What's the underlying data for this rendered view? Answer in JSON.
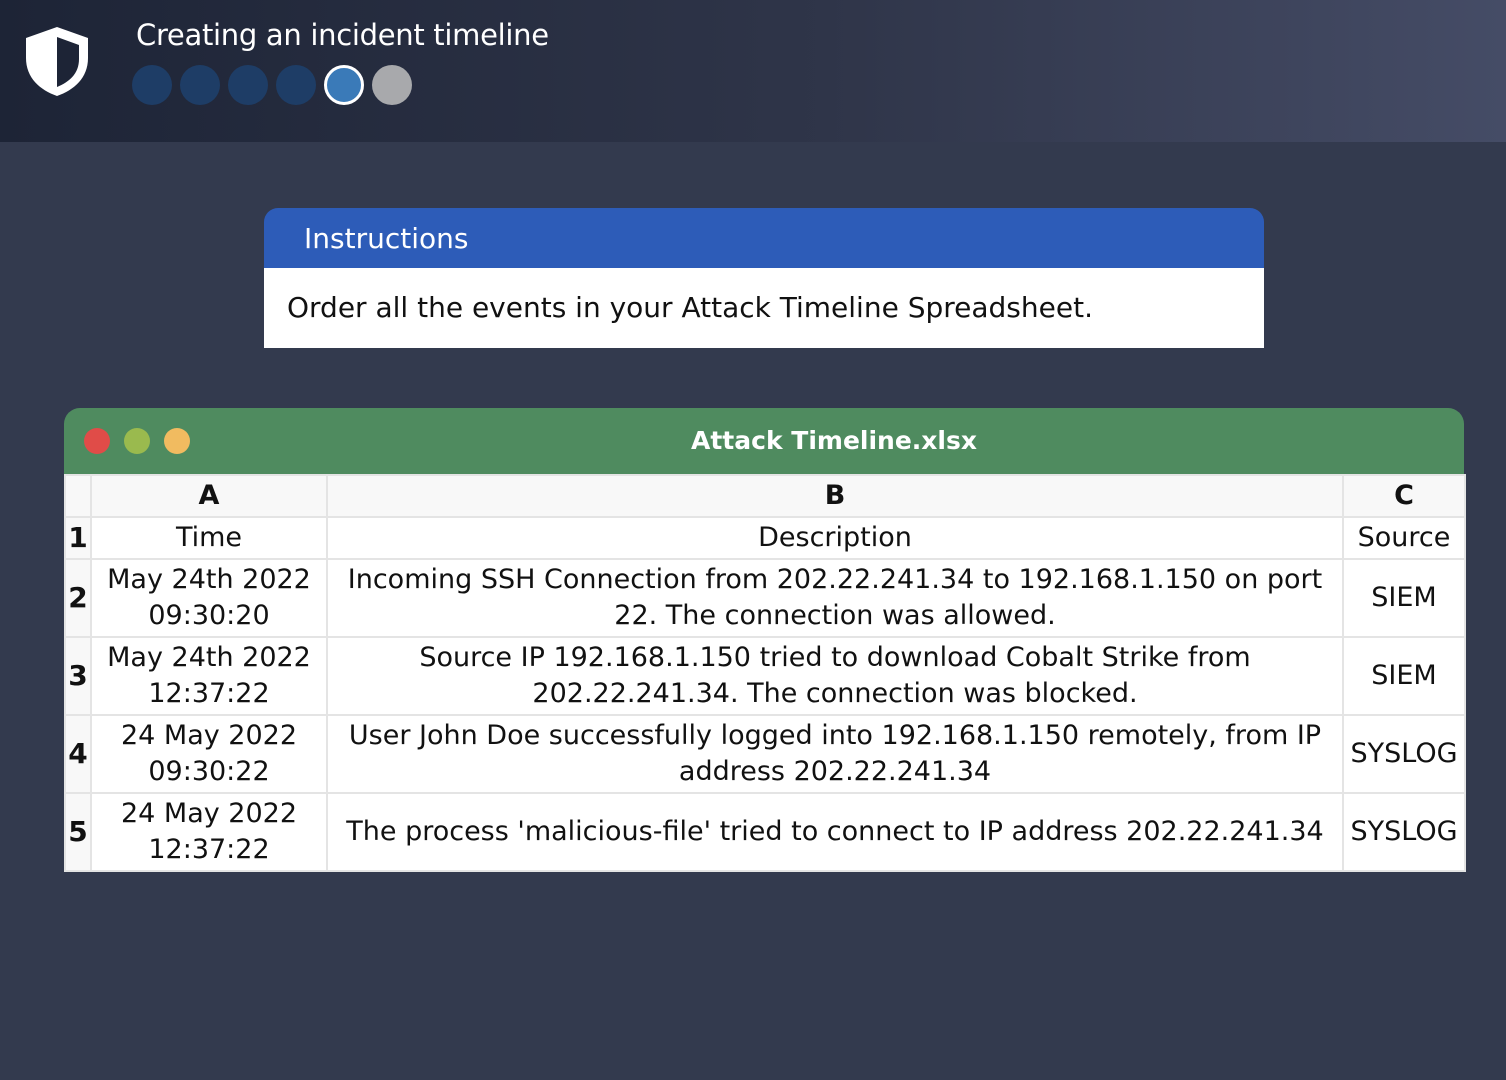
{
  "header": {
    "title": "Creating an incident timeline",
    "progress": {
      "total_steps": 6,
      "completed": 4,
      "current_step": 5
    }
  },
  "instructions": {
    "heading": "Instructions",
    "body": "Order all the events in your Attack Timeline Spreadsheet."
  },
  "spreadsheet": {
    "filename": "Attack Timeline.xlsx",
    "column_letters": [
      "A",
      "B",
      "C"
    ],
    "header_row": {
      "number": "1",
      "time": "Time",
      "description": "Description",
      "source": "Source"
    },
    "rows": [
      {
        "number": "2",
        "time_line1": "May 24th 2022",
        "time_line2": "09:30:20",
        "description": "Incoming SSH Connection from 202.22.241.34 to 192.168.1.150 on port 22. The connection was allowed.",
        "source": "SIEM"
      },
      {
        "number": "3",
        "time_line1": "May 24th 2022",
        "time_line2": "12:37:22",
        "description": "Source IP 192.168.1.150 tried to download Cobalt Strike from 202.22.241.34. The connection was blocked.",
        "source": "SIEM"
      },
      {
        "number": "4",
        "time_line1": "24 May 2022",
        "time_line2": "09:30:22",
        "description": "User John Doe successfully logged into 192.168.1.150 remotely, from IP address 202.22.241.34",
        "source": "SYSLOG"
      },
      {
        "number": "5",
        "time_line1": "24 May 2022",
        "time_line2": "12:37:22",
        "description": "The process 'malicious-file' tried to connect to IP address 202.22.241.34",
        "source": "SYSLOG"
      }
    ]
  },
  "colors": {
    "background": "#333a4e",
    "instructions_header": "#2d5cb8",
    "window_bar": "#4f8b5f",
    "progress_done": "#1e3d66",
    "progress_current": "#3a7ab8",
    "progress_todo": "#a8a9ac"
  }
}
